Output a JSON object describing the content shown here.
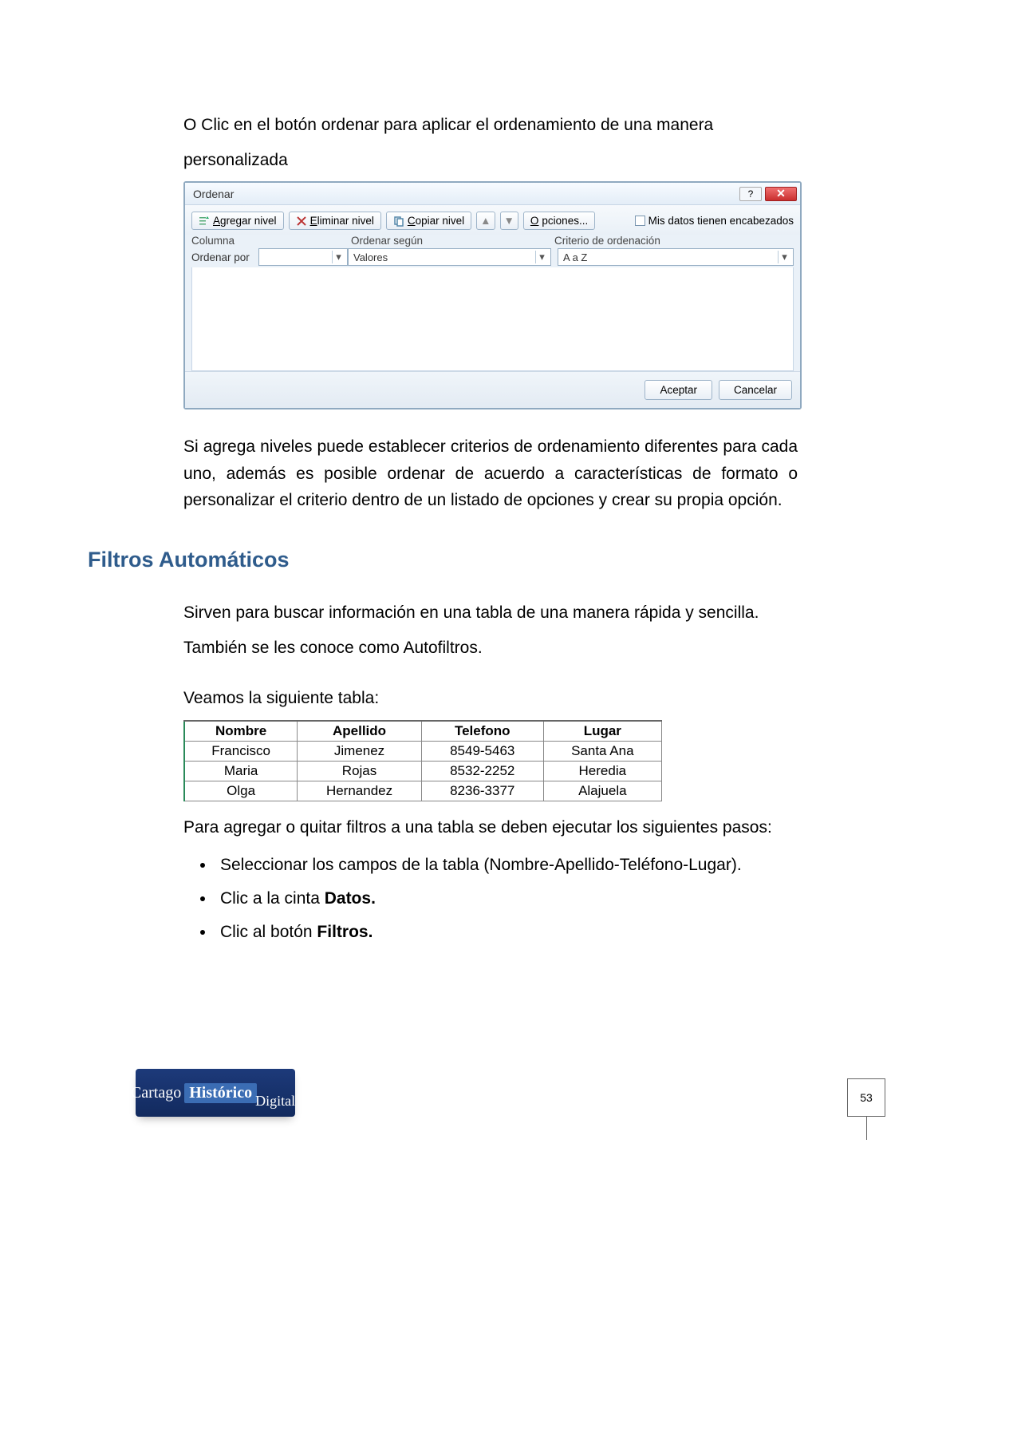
{
  "intro": {
    "line1": "O Clic en el botón ordenar para aplicar el ordenamiento de una manera",
    "line2": "personalizada"
  },
  "dialog": {
    "title": "Ordenar",
    "add_level": "Agregar nivel",
    "remove_level": "Eliminar nivel",
    "copy_level": "Copiar nivel",
    "options": "Opciones...",
    "headers_checkbox": "Mis datos tienen encabezados",
    "col_header": "Columna",
    "sort_on_header": "Ordenar según",
    "order_header": "Criterio de ordenación",
    "row_label": "Ordenar por",
    "sort_on_value": "Valores",
    "order_value": "A a Z",
    "accept": "Aceptar",
    "cancel": "Cancelar"
  },
  "para2": "Si agrega niveles puede establecer criterios de ordenamiento diferentes para cada uno, además es posible ordenar de acuerdo a características de formato o personalizar el criterio dentro de un listado de opciones y crear su propia opción.",
  "heading": "Filtros Automáticos",
  "para3a": "Sirven para buscar información en una tabla de una manera rápida y sencilla.",
  "para3b": "También se les conoce como Autofiltros.",
  "para4": "Veamos la siguiente tabla:",
  "table": {
    "headers": [
      "Nombre",
      "Apellido",
      "Telefono",
      "Lugar"
    ],
    "rows": [
      [
        "Francisco",
        "Jimenez",
        "8549-5463",
        "Santa Ana"
      ],
      [
        "Maria",
        "Rojas",
        "8532-2252",
        "Heredia"
      ],
      [
        "Olga",
        "Hernandez",
        "8236-3377",
        "Alajuela"
      ]
    ]
  },
  "para5": "Para agregar o quitar filtros a una tabla se deben ejecutar los siguientes pasos:",
  "steps": {
    "s1": "Seleccionar los campos de la tabla (Nombre-Apellido-Teléfono-Lugar).",
    "s2a": "Clic a la cinta ",
    "s2b": "Datos.",
    "s3a": "Clic al botón ",
    "s3b": "Filtros."
  },
  "logo": {
    "t1": "Cartago",
    "t2": "Histórico",
    "t3": "Digital"
  },
  "pagenum": "53"
}
